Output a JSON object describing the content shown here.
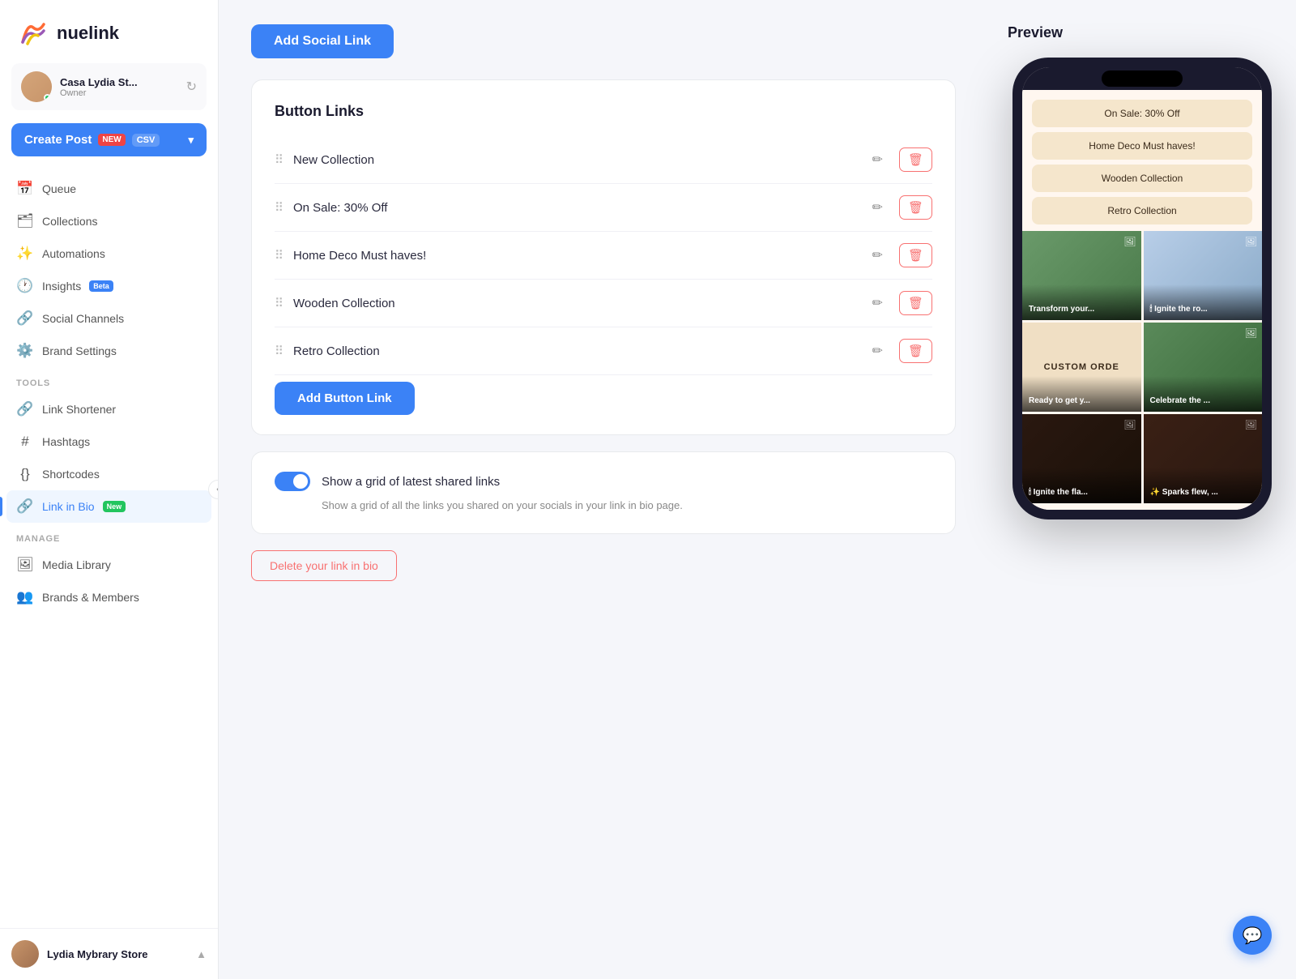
{
  "app": {
    "name": "nuelink"
  },
  "sidebar": {
    "account": {
      "name": "Casa Lydia St...",
      "role": "Owner"
    },
    "create_post_label": "Create Post",
    "new_badge": "new",
    "csv_badge": "CSV",
    "nav_items": [
      {
        "id": "queue",
        "label": "Queue",
        "icon": "📅"
      },
      {
        "id": "collections",
        "label": "Collections",
        "icon": "🗂"
      },
      {
        "id": "automations",
        "label": "Automations",
        "icon": "✨"
      },
      {
        "id": "insights",
        "label": "Insights",
        "icon": "🕐",
        "badge": "Beta"
      },
      {
        "id": "social-channels",
        "label": "Social Channels",
        "icon": "🔗"
      },
      {
        "id": "brand-settings",
        "label": "Brand Settings",
        "icon": "⚙️"
      }
    ],
    "tools_label": "TOOLS",
    "tools_items": [
      {
        "id": "link-shortener",
        "label": "Link Shortener",
        "icon": "🔗"
      },
      {
        "id": "hashtags",
        "label": "Hashtags",
        "icon": "#"
      },
      {
        "id": "shortcodes",
        "label": "Shortcodes",
        "icon": "{}"
      },
      {
        "id": "link-in-bio",
        "label": "Link in Bio",
        "icon": "🔗",
        "badge": "New",
        "active": true
      }
    ],
    "manage_label": "MANAGE",
    "manage_items": [
      {
        "id": "media-library",
        "label": "Media Library",
        "icon": "🖼"
      },
      {
        "id": "brands-members",
        "label": "Brands & Members",
        "icon": "👥"
      }
    ],
    "footer": {
      "name": "Lydia Mybrary Store",
      "chevron": "▲"
    }
  },
  "main": {
    "add_social_link_label": "Add Social Link",
    "button_links_title": "Button Links",
    "links": [
      {
        "id": 1,
        "name": "New Collection"
      },
      {
        "id": 2,
        "name": "On Sale: 30% Off"
      },
      {
        "id": 3,
        "name": "Home Deco Must haves!"
      },
      {
        "id": 4,
        "name": "Wooden Collection"
      },
      {
        "id": 5,
        "name": "Retro Collection"
      }
    ],
    "add_button_link_label": "Add Button Link",
    "toggle": {
      "label": "Show a grid of latest shared links",
      "description": "Show a grid of all the links you shared on your socials in your link in bio page."
    },
    "delete_link_label": "Delete your link in bio"
  },
  "preview": {
    "title": "Preview",
    "phone_buttons": [
      "On Sale: 30% Off",
      "Home Deco Must haves!",
      "Wooden Collection",
      "Retro Collection"
    ],
    "grid_cells": [
      {
        "label": "Transform your...",
        "icon": "🖼",
        "bg": "green"
      },
      {
        "label": "Ignite the ro...",
        "icon": "🕯",
        "bg": "blue"
      },
      {
        "label": "Ready to get y...",
        "icon": "",
        "bg": "cream",
        "text": "CUSTOM ORDE"
      },
      {
        "label": "Celebrate the ...",
        "icon": "🖼",
        "bg": "plants"
      },
      {
        "label": "Ignite the fla...",
        "icon": "🕯",
        "bg": "dark1"
      },
      {
        "label": "✨ Sparks flew, ...",
        "icon": "🖼",
        "bg": "dark2"
      }
    ]
  }
}
